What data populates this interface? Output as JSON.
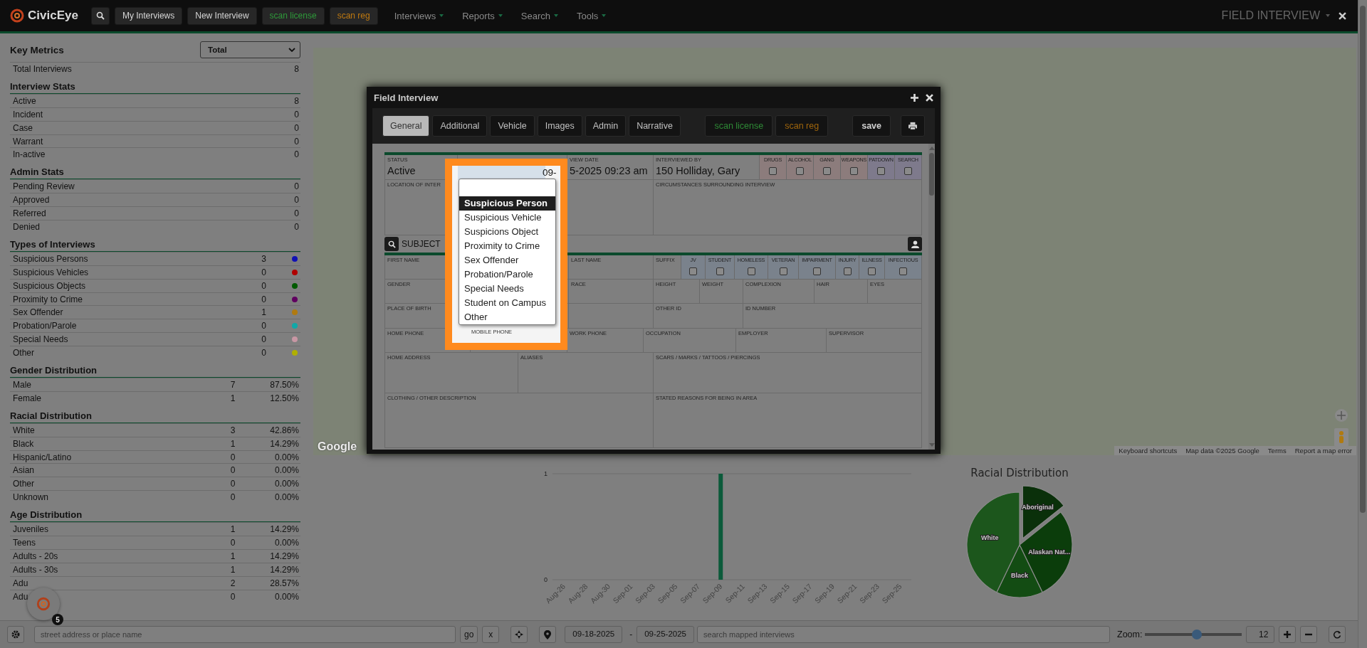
{
  "topbar": {
    "brand": "CivicEye",
    "buttons": [
      {
        "label": "My Interviews",
        "kind": "plain"
      },
      {
        "label": "New Interview",
        "kind": "plain"
      },
      {
        "label": "scan license",
        "kind": "license"
      },
      {
        "label": "scan reg",
        "kind": "reg"
      }
    ],
    "menus": [
      "Interviews",
      "Reports",
      "Search",
      "Tools"
    ],
    "page_title": "FIELD INTERVIEW"
  },
  "metrics": {
    "title": "Key Metrics",
    "period": "Total",
    "total": {
      "label": "Total Interviews",
      "count": "8"
    },
    "sections": [
      {
        "title": "Interview Stats",
        "kind": "count",
        "rows": [
          {
            "label": "Active",
            "count": "8"
          },
          {
            "label": "Incident",
            "count": "0"
          },
          {
            "label": "Case",
            "count": "0"
          },
          {
            "label": "Warrant",
            "count": "0"
          },
          {
            "label": "In-active",
            "count": "0"
          }
        ]
      },
      {
        "title": "Admin Stats",
        "kind": "count",
        "rows": [
          {
            "label": "Pending Review",
            "count": "0"
          },
          {
            "label": "Approved",
            "count": "0"
          },
          {
            "label": "Referred",
            "count": "0"
          },
          {
            "label": "Denied",
            "count": "0"
          }
        ]
      },
      {
        "title": "Types of Interviews",
        "kind": "dot",
        "rows": [
          {
            "label": "Suspicious Persons",
            "count": "3",
            "color": "#1010b4"
          },
          {
            "label": "Suspicious Vehicles",
            "count": "0",
            "color": "#b00000"
          },
          {
            "label": "Suspicious Objects",
            "count": "0",
            "color": "#005a00"
          },
          {
            "label": "Proximity to Crime",
            "count": "0",
            "color": "#600060"
          },
          {
            "label": "Sex Offender",
            "count": "1",
            "color": "#b07a10"
          },
          {
            "label": "Probation/Parole",
            "count": "0",
            "color": "#10a8a8"
          },
          {
            "label": "Special Needs",
            "count": "0",
            "color": "#c897a4"
          },
          {
            "label": "Other",
            "count": "0",
            "color": "#b0b000"
          }
        ]
      },
      {
        "title": "Gender Distribution",
        "kind": "percent",
        "rows": [
          {
            "label": "Male",
            "count": "7",
            "percent": "87.50%"
          },
          {
            "label": "Female",
            "count": "1",
            "percent": "12.50%"
          }
        ]
      },
      {
        "title": "Racial Distribution",
        "kind": "percent",
        "rows": [
          {
            "label": "White",
            "count": "3",
            "percent": "42.86%"
          },
          {
            "label": "Black",
            "count": "1",
            "percent": "14.29%"
          },
          {
            "label": "Hispanic/Latino",
            "count": "0",
            "percent": "0.00%"
          },
          {
            "label": "Asian",
            "count": "0",
            "percent": "0.00%"
          },
          {
            "label": "Other",
            "count": "0",
            "percent": "0.00%"
          },
          {
            "label": "Unknown",
            "count": "0",
            "percent": "0.00%"
          }
        ]
      },
      {
        "title": "Age Distribution",
        "kind": "percent",
        "rows": [
          {
            "label": "Juveniles",
            "count": "1",
            "percent": "14.29%"
          },
          {
            "label": "Teens",
            "count": "0",
            "percent": "0.00%"
          },
          {
            "label": "Adults - 20s",
            "count": "1",
            "percent": "14.29%"
          },
          {
            "label": "Adults - 30s",
            "count": "1",
            "percent": "14.29%"
          },
          {
            "label": "Adu",
            "count": "2",
            "percent": "28.57%"
          },
          {
            "label": "Adu",
            "count": "0",
            "percent": "0.00%"
          }
        ]
      }
    ]
  },
  "map": {
    "logo": "Google",
    "attribution": [
      "Keyboard shortcuts",
      "Map data ©2025 Google",
      "Terms",
      "Report a map error"
    ]
  },
  "charts": {
    "activity": {
      "chart_data": {
        "type": "bar",
        "categories": [
          "Aug-26",
          "Aug-28",
          "Aug-30",
          "Sep-01",
          "Sep-03",
          "Sep-05",
          "Sep-07",
          "Sep-09",
          "Sep-11",
          "Sep-13",
          "Sep-15",
          "Sep-17",
          "Sep-19",
          "Sep-21",
          "Sep-23",
          "Sep-25"
        ],
        "values": [
          0,
          0,
          0,
          0,
          0,
          0,
          0,
          1,
          0,
          0,
          0,
          0,
          0,
          0,
          0,
          0
        ],
        "ylim": [
          0,
          1
        ],
        "yticks": [
          0,
          1
        ]
      }
    },
    "racial": {
      "chart_data": {
        "type": "pie",
        "title": "Racial Distribution",
        "categories": [
          "Aboriginal",
          "Alaskan Nat...",
          "Black",
          "White"
        ],
        "values": [
          14.29,
          28.57,
          14.29,
          42.86
        ]
      }
    }
  },
  "bottom_bar": {
    "address_placeholder": "street address or place name",
    "go": "go",
    "clear": "x",
    "date_from": "09-18-2025",
    "date_separator": "-",
    "date_to": "09-25-2025",
    "search_placeholder": "search mapped interviews",
    "zoom_label": "Zoom:",
    "zoom": {
      "level": 0.53
    },
    "zoom_value": "12"
  },
  "floating_badge": {
    "count": "5"
  },
  "field_interview": {
    "title": "Field Interview",
    "tabs": [
      {
        "label": "General",
        "selected": true
      },
      {
        "label": "Additional",
        "selected": false
      },
      {
        "label": "Vehicle",
        "selected": false
      },
      {
        "label": "Images",
        "selected": false
      },
      {
        "label": "Admin",
        "selected": false
      },
      {
        "label": "Narrative",
        "selected": false
      }
    ],
    "actions": [
      {
        "label": "scan license",
        "kind": "license"
      },
      {
        "label": "scan reg",
        "kind": "reg"
      },
      {
        "label": "save",
        "kind": "save"
      }
    ],
    "header_rows": [
      {
        "cells": [
          {
            "kind": "field",
            "label": "STATUS",
            "value": "Active"
          },
          {
            "kind": "blank"
          },
          {
            "kind": "field",
            "label": "VIEW DATE",
            "value": "5-2025 09:23 am"
          },
          {
            "kind": "field",
            "label": "INTERVIEWED BY",
            "value": "150 Holliday, Gary"
          },
          {
            "kind": "flag",
            "label": "DRUGS",
            "checked": false,
            "color": "#8c7c7c"
          },
          {
            "kind": "flag",
            "label": "ALCOHOL",
            "checked": false,
            "color": "#8c7c7c"
          },
          {
            "kind": "flag",
            "label": "GANG",
            "checked": false,
            "color": "#8c7c7c"
          },
          {
            "kind": "flag",
            "label": "WEAPONS",
            "checked": false,
            "color": "#8c7c7c"
          },
          {
            "kind": "flag",
            "label": "PATDOWN",
            "checked": false,
            "color": "#7e7a8c"
          },
          {
            "kind": "flag",
            "label": "SEARCH",
            "checked": false,
            "color": "#7e7a8c"
          }
        ]
      },
      {
        "cells": [
          {
            "kind": "field",
            "label": "LOCATION OF INTER"
          },
          {
            "kind": "field",
            "label": "CIRCUMSTANCES SURROUNDING INTERVIEW"
          }
        ]
      }
    ],
    "subject_label": "SUBJECT",
    "subject_rows": [
      {
        "cells": [
          {
            "kind": "field",
            "label": "FIRST NAME"
          },
          {
            "kind": "field",
            "label": "LAST NAME"
          },
          {
            "kind": "field",
            "label": "SUFFIX"
          },
          {
            "kind": "flag",
            "label": "JV",
            "checked": false,
            "color": "#7a828c"
          },
          {
            "kind": "flag",
            "label": "STUDENT",
            "checked": false,
            "color": "#7a828c"
          },
          {
            "kind": "flag",
            "label": "HOMELESS",
            "checked": false,
            "color": "#7a828c"
          },
          {
            "kind": "flag",
            "label": "VETERAN",
            "checked": false,
            "color": "#7a828c"
          },
          {
            "kind": "flag",
            "label": "IMPAIRMENT",
            "checked": false,
            "color": "#7a828c"
          },
          {
            "kind": "flag",
            "label": "INJURY",
            "checked": false,
            "color": "#7a828c"
          },
          {
            "kind": "flag",
            "label": "ILLNESS",
            "checked": false,
            "color": "#7a828c"
          },
          {
            "kind": "flag",
            "label": "INFECTIOUS",
            "checked": false,
            "color": "#7a828c"
          }
        ]
      },
      {
        "cells": [
          {
            "kind": "field",
            "label": "GENDER"
          },
          {
            "kind": "field",
            "label": "RACE"
          },
          {
            "kind": "field",
            "label": "HEIGHT"
          },
          {
            "kind": "field",
            "label": "WEIGHT"
          },
          {
            "kind": "field",
            "label": "COMPLEXION"
          },
          {
            "kind": "field",
            "label": "HAIR"
          },
          {
            "kind": "field",
            "label": "EYES"
          }
        ]
      },
      {
        "cells": [
          {
            "kind": "field",
            "label": "PLACE OF BIRTH"
          },
          {
            "kind": "blank"
          },
          {
            "kind": "field",
            "label": "OTHER ID"
          },
          {
            "kind": "field",
            "label": "ID NUMBER"
          }
        ]
      },
      {
        "cells": [
          {
            "kind": "field",
            "label": "HOME PHONE"
          },
          {
            "kind": "blank"
          },
          {
            "kind": "field",
            "label": "WORK PHONE"
          },
          {
            "kind": "field",
            "label": "OCCUPATION"
          },
          {
            "kind": "field",
            "label": "EMPLOYER"
          },
          {
            "kind": "field",
            "label": "SUPERVISOR"
          }
        ]
      },
      {
        "cells": [
          {
            "kind": "field",
            "label": "HOME ADDRESS"
          },
          {
            "kind": "field",
            "label": "ALIASES"
          },
          {
            "kind": "field",
            "label": "SCARS / MARKS / TATTOOS / PIERCINGS"
          }
        ]
      },
      {
        "cells": [
          {
            "kind": "field",
            "label": "CLOTHING / OTHER DESCRIPTION"
          },
          {
            "kind": "field",
            "label": "STATED REASONS FOR BEING IN AREA"
          }
        ]
      }
    ],
    "type_dropdown": {
      "date_prefix": "09-",
      "under_label": "MOBILE PHONE",
      "options": [
        {
          "label": "Suspicious Person",
          "selected": true
        },
        {
          "label": "Suspicious Vehicle",
          "selected": false
        },
        {
          "label": "Suspicions Object",
          "selected": false
        },
        {
          "label": "Proximity to Crime",
          "selected": false
        },
        {
          "label": "Sex Offender",
          "selected": false
        },
        {
          "label": "Probation/Parole",
          "selected": false
        },
        {
          "label": "Special Needs",
          "selected": false
        },
        {
          "label": "Student on Campus",
          "selected": false
        },
        {
          "label": "Other",
          "selected": false
        }
      ]
    }
  }
}
